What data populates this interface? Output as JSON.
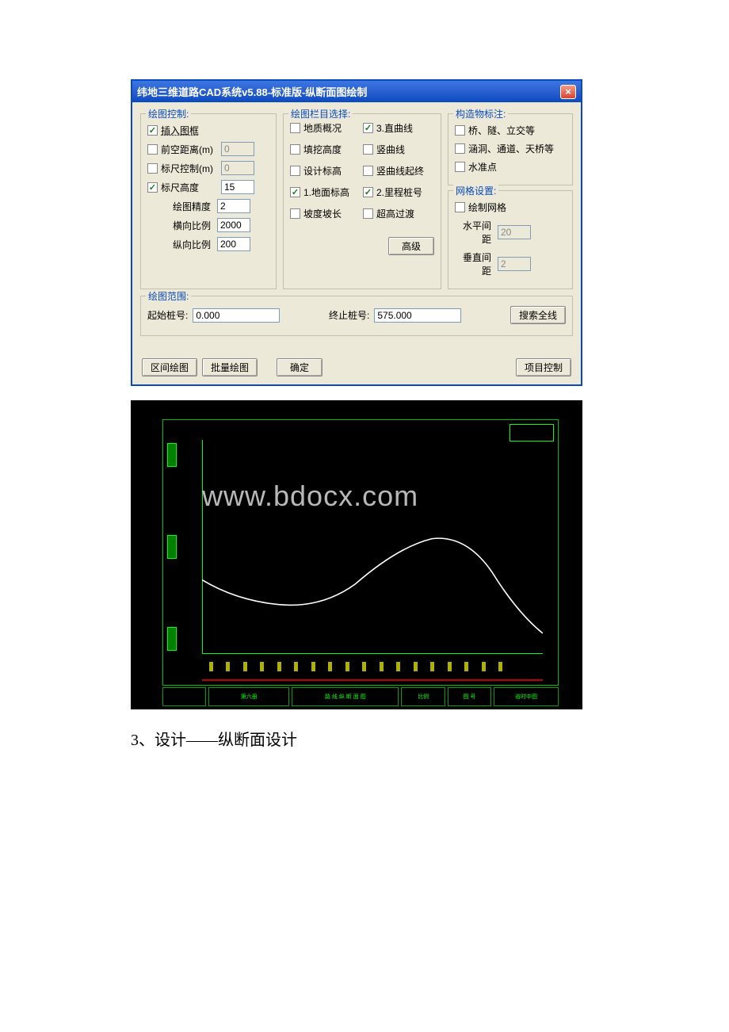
{
  "titlebar": "纬地三维道路CAD系统v5.88-标准版-纵断面图绘制",
  "close_icon": "×",
  "group1": {
    "title": "绘图控制:",
    "insert_frame": "插入图框",
    "front_dist": "前空距离(m)",
    "front_dist_val": "0",
    "ruler_ctrl": "标尺控制(m)",
    "ruler_ctrl_val": "0",
    "ruler_height": "标尺高度",
    "ruler_height_val": "15",
    "draw_precision": "绘图精度",
    "draw_precision_val": "2",
    "h_scale": "横向比例",
    "h_scale_val": "2000",
    "v_scale": "纵向比例",
    "v_scale_val": "200"
  },
  "group2": {
    "title": "绘图栏目选择:",
    "geo": "地质概况",
    "straight": "3.直曲线",
    "fill": "填挖高度",
    "vcurve": "竖曲线",
    "design_elev": "设计标高",
    "vcurve_se": "竖曲线起终",
    "ground_elev": "1.地面标高",
    "mile": "2.里程桩号",
    "slope": "坡度坡长",
    "super": "超高过渡",
    "advanced": "高级"
  },
  "group3a": {
    "title": "构造物标注:",
    "bridge": "桥、隧、立交等",
    "culvert": "涵洞、通道、天桥等",
    "bm": "水准点"
  },
  "group3b": {
    "title": "网格设置:",
    "draw_grid": "绘制网格",
    "h_gap": "水平间距",
    "h_gap_val": "20",
    "v_gap": "垂直间距",
    "v_gap_val": "2"
  },
  "range": {
    "title": "绘图范围:",
    "start_label": "起始桩号:",
    "start_val": "0.000",
    "end_label": "终止桩号:",
    "end_val": "575.000",
    "search": "搜索全线"
  },
  "buttons": {
    "interval": "区间绘图",
    "batch": "批量绘图",
    "ok": "确定",
    "proj": "项目控制"
  },
  "watermark": "www.bdocx.com",
  "caption": "3、设计——纵断面设计"
}
